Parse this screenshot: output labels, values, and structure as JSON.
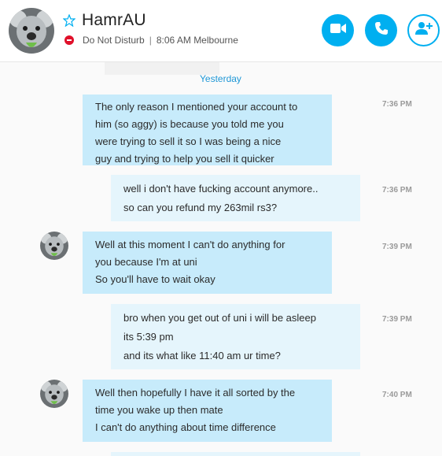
{
  "header": {
    "contact_name": "HamrAU",
    "status": "Do Not Disturb",
    "separator": "|",
    "local_time": "8:06 AM Melbourne",
    "favorite_icon": "star-outline-icon",
    "status_icon": "do-not-disturb-icon",
    "actions": [
      {
        "name": "video-call",
        "icon": "video-camera-icon"
      },
      {
        "name": "audio-call",
        "icon": "phone-icon"
      },
      {
        "name": "add-people",
        "icon": "add-person-icon"
      }
    ]
  },
  "colors": {
    "accent": "#00aff0",
    "incoming_bubble": "#c7ebfb",
    "outgoing_bubble": "#e5f5fc",
    "day_label": "#1f97d6",
    "dnd_red": "#e0102a"
  },
  "day_separator": "Yesterday",
  "messages": [
    {
      "sender": "them",
      "time": "7:36 PM",
      "lines": [
        "The only reason I mentioned your account to",
        "him (so aggy) is because you told me you",
        "were trying to sell it so I was being a nice",
        "guy and trying to help you sell it quicker"
      ]
    },
    {
      "sender": "me",
      "time": "7:36 PM",
      "lines": [
        "well i don't have fucking account anymore..",
        "so can you refund my 263mil rs3?"
      ]
    },
    {
      "sender": "them",
      "time": "7:39 PM",
      "lines": [
        "Well at this moment I can't do anything for",
        "you because I'm at uni",
        "So you'll have to wait okay"
      ]
    },
    {
      "sender": "me",
      "time": "7:39 PM",
      "lines": [
        "bro when you get out of uni i will be asleep",
        "its 5:39 pm",
        "and its what like 11:40 am ur time?"
      ]
    },
    {
      "sender": "them",
      "time": "7:40 PM",
      "lines": [
        "Well then hopefully I have it all sorted by the",
        "time you wake up then mate",
        "I can't do anything about time difference"
      ]
    }
  ]
}
